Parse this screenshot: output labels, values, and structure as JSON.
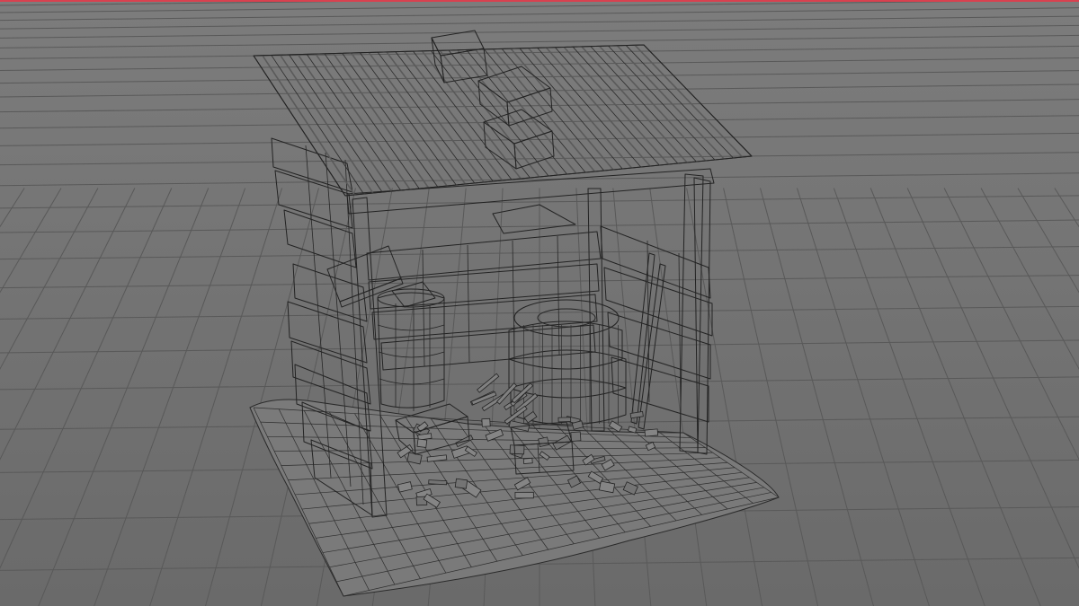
{
  "viewport": {
    "mode": "wireframe-on-shaded",
    "active_frame_color": "#d9414f",
    "background_color": "#6e6e6e",
    "grid_color": "#595959",
    "mesh_fill_color": "#777777",
    "wire_color": "#232323"
  },
  "scene": {
    "object": "shed",
    "parts": [
      "corrugated-roof",
      "roof-crates",
      "support-posts",
      "plank-walls",
      "hanging-sign",
      "barrel",
      "tire-stack",
      "wooden-crate",
      "rubble",
      "leaning-poles",
      "ground-patch"
    ]
  }
}
